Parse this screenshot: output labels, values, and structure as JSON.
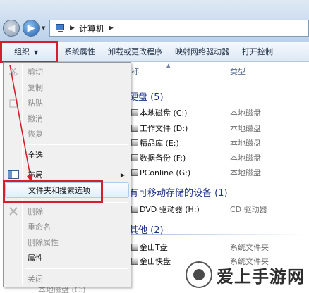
{
  "address": {
    "crumbs": [
      "计算机"
    ]
  },
  "toolbar": {
    "organize_label": "组织",
    "items": [
      "系统属性",
      "卸载或更改程序",
      "映射网络驱动器",
      "打开控制"
    ]
  },
  "columns": {
    "name": "称",
    "type": "类型"
  },
  "sections": {
    "hard_disks": "硬盘 (5)",
    "removable": "有可移动存储的设备 (1)",
    "other": "其他 (2)"
  },
  "drives": [
    {
      "name": "本地磁盘 (C:)",
      "type": "本地磁盘"
    },
    {
      "name": "工作文件 (D:)",
      "type": "本地磁盘"
    },
    {
      "name": "精品库 (E:)",
      "type": "本地磁盘"
    },
    {
      "name": "数据备份 (F:)",
      "type": "本地磁盘"
    },
    {
      "name": "PConline (G:)",
      "type": "本地磁盘"
    }
  ],
  "removable_drives": [
    {
      "name": "DVD 驱动器 (H:)",
      "type": "CD 驱动器"
    }
  ],
  "other_items": [
    {
      "name": "金山T盘",
      "type": "系统文件夹"
    },
    {
      "name": "金山快盘",
      "type": "系统文件夹"
    }
  ],
  "menu": {
    "cut": "剪切",
    "copy": "复制",
    "paste": "粘贴",
    "undo": "撤消",
    "redo": "恢复",
    "select_all": "全选",
    "layout": "布局",
    "folder_options": "文件夹和搜索选项",
    "delete": "删除",
    "rename": "重命名",
    "remove_properties": "删除属性",
    "properties": "属性",
    "close": "关闭"
  },
  "bottom_partial": "本地磁盘 (C:)",
  "watermark": "爱上手游网",
  "colors": {
    "annotation_red": "#d3202a",
    "section_blue": "#1e3287"
  }
}
